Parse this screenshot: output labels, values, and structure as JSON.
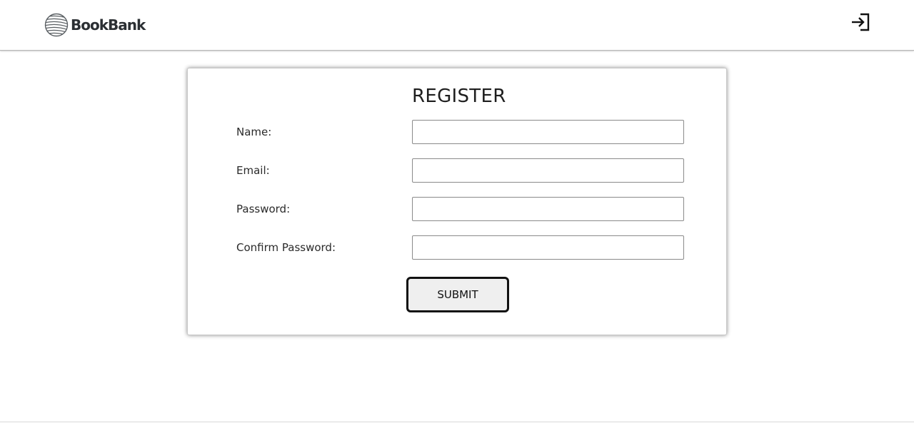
{
  "header": {
    "logo_text": "BookBank",
    "logo_icon": "globe-lines-icon",
    "login_icon": "sign-in-arrow-icon"
  },
  "register_form": {
    "title": "REGISTER",
    "fields": [
      {
        "label": "Name:",
        "value": "",
        "placeholder": ""
      },
      {
        "label": "Email:",
        "value": "",
        "placeholder": ""
      },
      {
        "label": "Password:",
        "value": "",
        "placeholder": ""
      },
      {
        "label": "Confirm Password:",
        "value": "",
        "placeholder": ""
      }
    ],
    "submit_label": "SUBMIT"
  }
}
